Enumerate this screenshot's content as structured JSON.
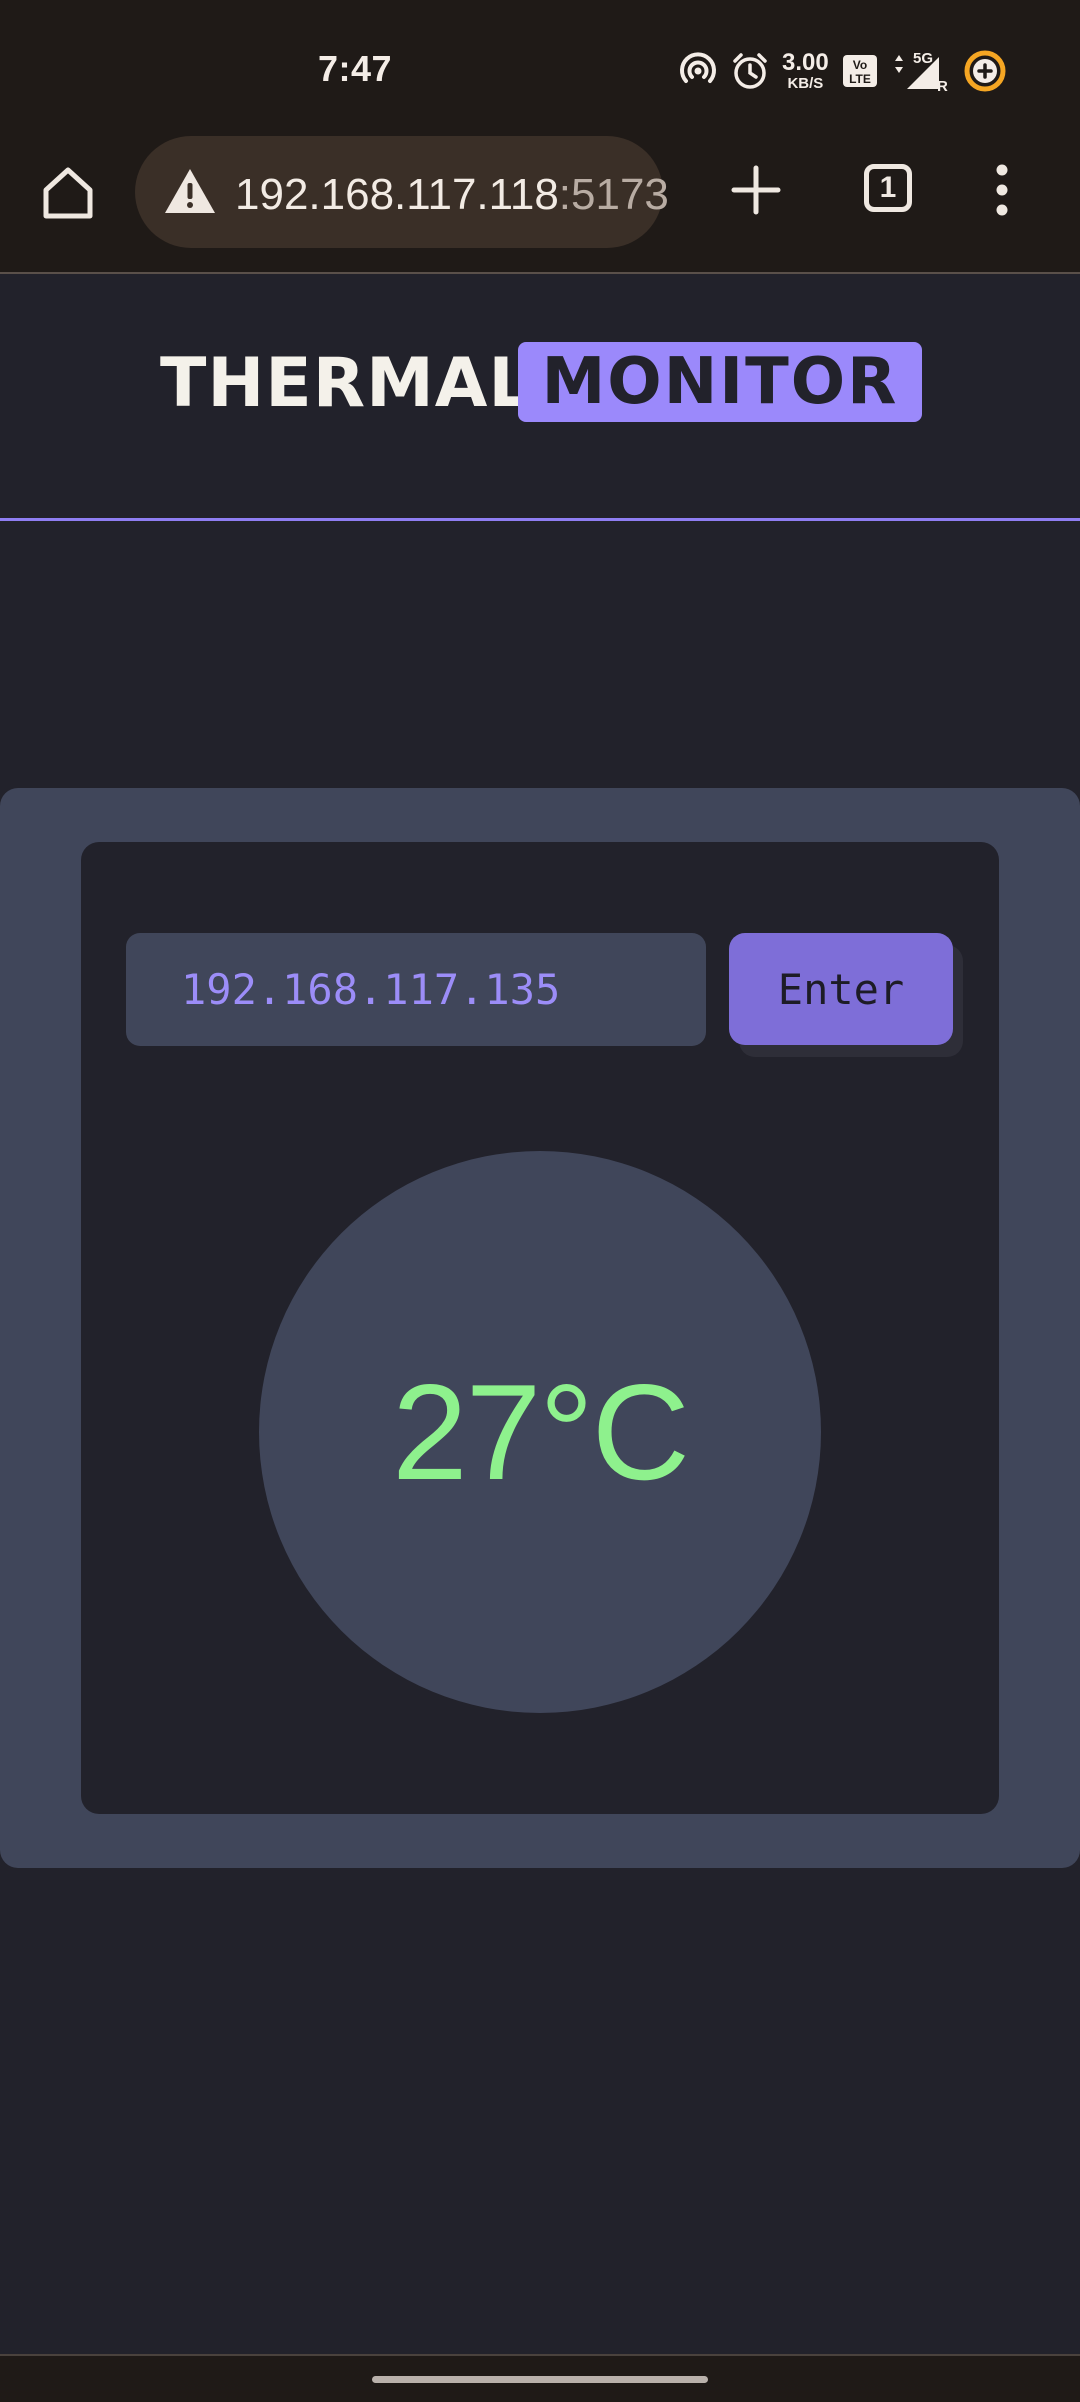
{
  "status_bar": {
    "time": "7:47",
    "net_speed_value": "3.00",
    "net_speed_unit": "KB/S",
    "network_type": "5G",
    "roaming": "R",
    "icons": [
      "hotspot-icon",
      "alarm-icon",
      "volte-icon",
      "signal-icon",
      "battery-saver-icon"
    ]
  },
  "browser": {
    "url_host": "192.168.117.118",
    "url_port": ":5173",
    "tab_count": "1",
    "icons": [
      "home-icon",
      "warning-icon",
      "plus-icon",
      "tabs-icon",
      "more-vert-icon"
    ]
  },
  "header": {
    "title_part1": "THERMAL",
    "title_part2": "MONITOR"
  },
  "form": {
    "ip_value": "192.168.117.135",
    "enter_label": "Enter"
  },
  "reading": {
    "temperature": "27°C"
  },
  "colors": {
    "background": "#22222b",
    "panel": "#40465a",
    "accent": "#9b89fb",
    "button": "#7e6ed8",
    "temperature": "#8ef18d",
    "ip_text": "#9c8df8"
  }
}
